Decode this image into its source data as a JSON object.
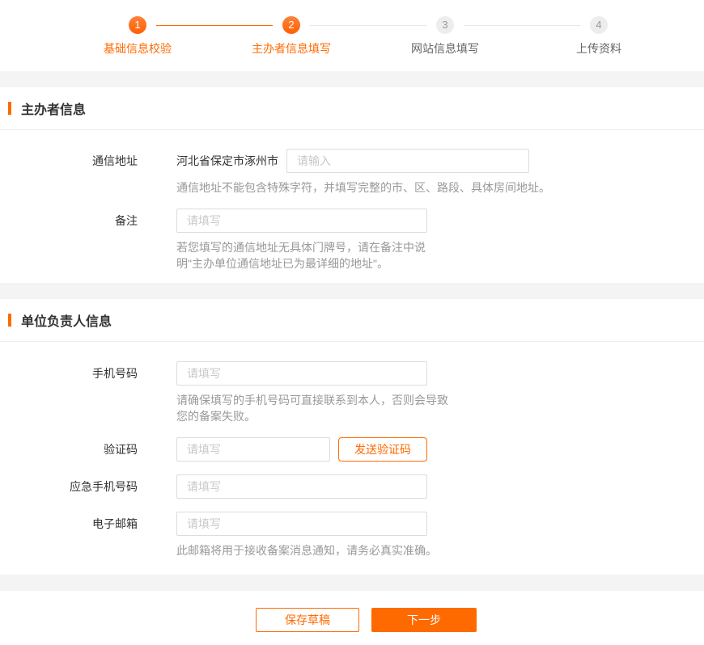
{
  "colors": {
    "accent": "#ff6a00",
    "band": "#f4f4f4"
  },
  "stepper": {
    "steps": [
      {
        "number": "1",
        "label": "基础信息校验",
        "state": "done"
      },
      {
        "number": "2",
        "label": "主办者信息填写",
        "state": "current"
      },
      {
        "number": "3",
        "label": "网站信息填写",
        "state": "pending"
      },
      {
        "number": "4",
        "label": "上传资料",
        "state": "pending"
      }
    ]
  },
  "organizer": {
    "title": "主办者信息",
    "address": {
      "label": "通信地址",
      "region_prefix": "河北省保定市涿州市",
      "placeholder": "请输入",
      "help": "通信地址不能包含特殊字符，并填写完整的市、区、路段、具体房间地址。"
    },
    "remark": {
      "label": "备注",
      "placeholder": "请填写",
      "help": "若您填写的通信地址无具体门牌号，请在备注中说明\"主办单位通信地址已为最详细的地址\"。"
    }
  },
  "contact": {
    "title": "单位负责人信息",
    "mobile": {
      "label": "手机号码",
      "placeholder": "请填写",
      "help": "请确保填写的手机号码可直接联系到本人，否则会导致您的备案失败。"
    },
    "captcha": {
      "label": "验证码",
      "placeholder": "请填写",
      "send_button": "发送验证码"
    },
    "emergency": {
      "label": "应急手机号码",
      "placeholder": "请填写"
    },
    "email": {
      "label": "电子邮箱",
      "placeholder": "请填写",
      "help": "此邮箱将用于接收备案消息通知，请务必真实准确。"
    }
  },
  "footer": {
    "save_draft": "保存草稿",
    "next": "下一步"
  }
}
